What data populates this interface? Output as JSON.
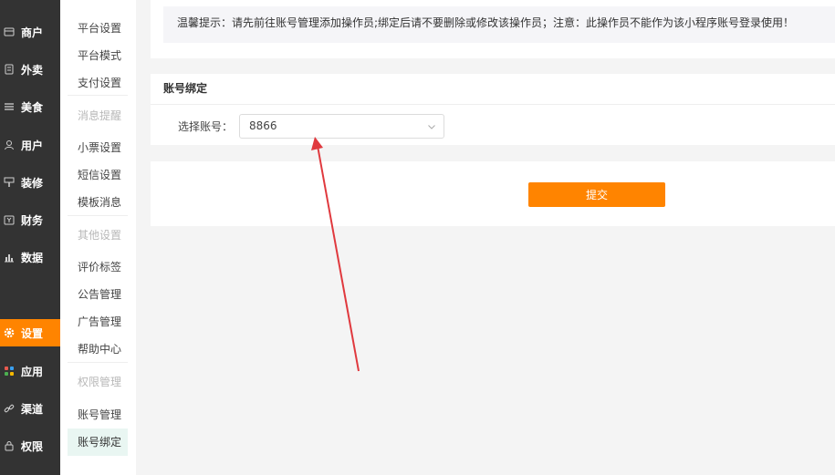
{
  "main_nav": [
    {
      "label": "商户",
      "icon": "store-icon"
    },
    {
      "label": "外卖",
      "icon": "document-icon"
    },
    {
      "label": "美食",
      "icon": "menu-lines-icon"
    },
    {
      "label": "用户",
      "icon": "user-icon"
    },
    {
      "label": "装修",
      "icon": "decorate-icon"
    },
    {
      "label": "财务",
      "icon": "wallet-icon"
    },
    {
      "label": "数据",
      "icon": "bar-chart-icon"
    },
    {
      "label": "设置",
      "icon": "gear-icon",
      "active": true
    },
    {
      "label": "应用",
      "icon": "apps-icon"
    },
    {
      "label": "渠道",
      "icon": "link-icon"
    },
    {
      "label": "权限",
      "icon": "lock-icon"
    }
  ],
  "sub_nav": {
    "items": [
      {
        "label": "平台设置"
      },
      {
        "label": "平台模式"
      },
      {
        "label": "支付设置"
      },
      {
        "label": "消息提醒",
        "group": true
      },
      {
        "label": "小票设置"
      },
      {
        "label": "短信设置"
      },
      {
        "label": "模板消息"
      },
      {
        "label": "其他设置",
        "group": true
      },
      {
        "label": "评价标签"
      },
      {
        "label": "公告管理"
      },
      {
        "label": "广告管理"
      },
      {
        "label": "帮助中心"
      },
      {
        "label": "权限管理",
        "group": true
      },
      {
        "label": "账号管理"
      },
      {
        "label": "账号绑定",
        "active": true
      }
    ]
  },
  "notice": {
    "text": "温馨提示：请先前往账号管理添加操作员;绑定后请不要删除或修改该操作员；注意：此操作员不能作为该小程序账号登录使用！"
  },
  "bind": {
    "title": "账号绑定",
    "account_label": "选择账号：",
    "account_value": "8866"
  },
  "submit": {
    "label": "提交"
  },
  "colors": {
    "sidebar_bg": "#333333",
    "accent": "#ff8400",
    "active_sub_bg": "#e9f6f2",
    "annotation": "#e0393e"
  }
}
